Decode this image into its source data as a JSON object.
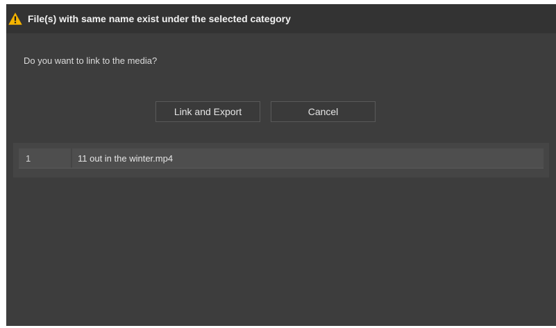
{
  "dialog": {
    "title": "File(s) with same name exist under the selected category",
    "title_icon": "warning-icon",
    "message": "Do you want to link to the media?",
    "buttons": {
      "link_export": "Link and Export",
      "cancel": "Cancel"
    },
    "files": [
      {
        "index": "1",
        "name": "11 out in the winter.mp4"
      }
    ]
  },
  "colors": {
    "dialog_bg": "#3d3d3d",
    "titlebar_bg": "#333333",
    "warning_yellow": "#f5b400",
    "row_bg": "#4e4e4e"
  }
}
